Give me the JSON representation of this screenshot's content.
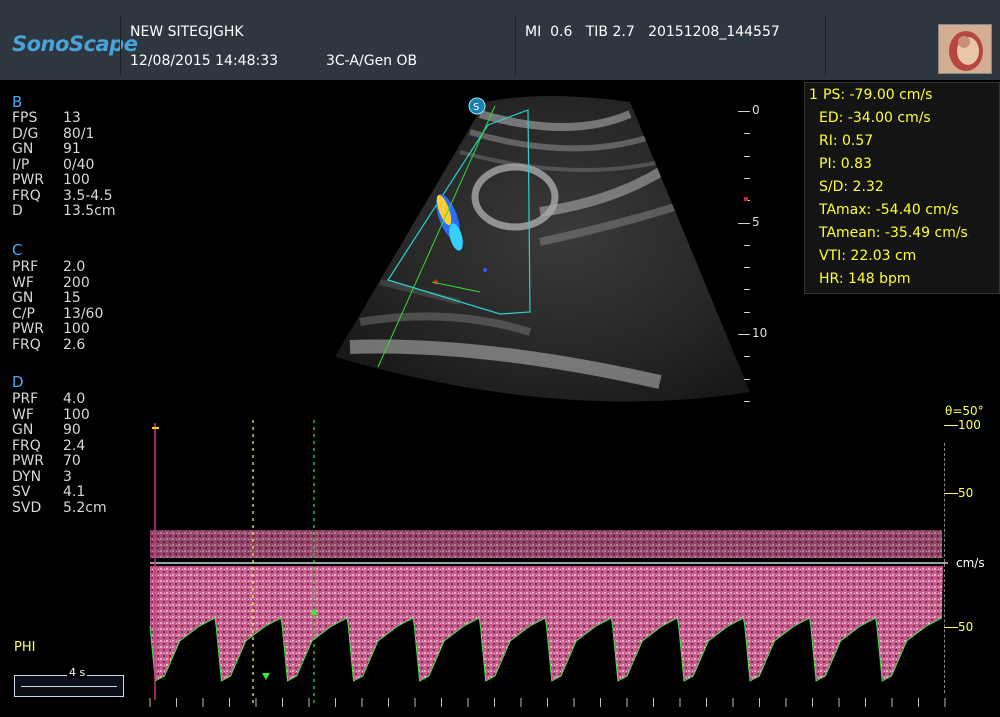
{
  "header": {
    "brand": "SonoScape",
    "site": "NEW SITEGJGHK",
    "datetime": "12/08/2015 14:48:33",
    "probe_preset": "3C-A/Gen OB",
    "mi_tib_file": "MI  0.6   TIB 2.7   20151208_144557"
  },
  "params": {
    "b_title": "B",
    "b": [
      {
        "k": "FPS",
        "v": "13"
      },
      {
        "k": "D/G",
        "v": "80/1"
      },
      {
        "k": "GN",
        "v": "91"
      },
      {
        "k": "I/P",
        "v": "0/40"
      },
      {
        "k": "PWR",
        "v": "100"
      },
      {
        "k": "FRQ",
        "v": "3.5-4.5"
      },
      {
        "k": "D",
        "v": "13.5cm"
      }
    ],
    "c_title": "C",
    "c": [
      {
        "k": "PRF",
        "v": "2.0"
      },
      {
        "k": "WF",
        "v": "200"
      },
      {
        "k": "GN",
        "v": "15"
      },
      {
        "k": "C/P",
        "v": "13/60"
      },
      {
        "k": "PWR",
        "v": "100"
      },
      {
        "k": "FRQ",
        "v": "2.6"
      }
    ],
    "d_title": "D",
    "d": [
      {
        "k": "PRF",
        "v": "4.0"
      },
      {
        "k": "WF",
        "v": "100"
      },
      {
        "k": "GN",
        "v": "90"
      },
      {
        "k": "FRQ",
        "v": "2.4"
      },
      {
        "k": "PWR",
        "v": "70"
      },
      {
        "k": "DYN",
        "v": "3"
      },
      {
        "k": "SV",
        "v": "4.1"
      },
      {
        "k": "SVD",
        "v": "5.2cm"
      }
    ]
  },
  "measurements": {
    "index": "1",
    "items": [
      "PS: -79.00 cm/s",
      "ED: -34.00 cm/s",
      "RI: 0.57",
      "PI: 0.83",
      "S/D: 2.32",
      "TAmax: -54.40 cm/s",
      "TAmean: -35.49 cm/s",
      "VTI: 22.03  cm",
      "HR: 148   bpm"
    ]
  },
  "depth_scale": {
    "labels": [
      "0",
      "5",
      "10"
    ]
  },
  "doppler": {
    "angle": "θ=50°",
    "scale_labels": [
      "100",
      "50",
      "cm/s",
      "50"
    ],
    "phi": "PHI",
    "time_scale": "4 s"
  },
  "colors": {
    "accent_blue": "#4aa8ff",
    "measure_yellow": "#ffff33",
    "spectrum_pink": "#d86a9c",
    "baseline_green": "#44dd44"
  }
}
